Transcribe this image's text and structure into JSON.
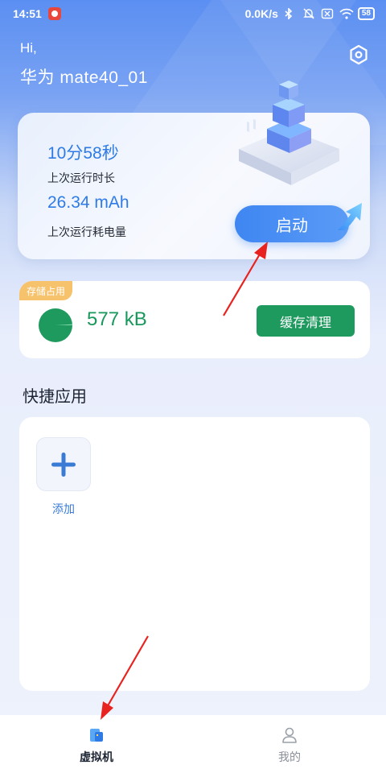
{
  "status_bar": {
    "time": "14:51",
    "net_speed": "0.0K/s",
    "battery": "58"
  },
  "header": {
    "hi": "Hi,",
    "device_name": "华为 mate40_01"
  },
  "run_card": {
    "last_run_duration": "10分58秒",
    "last_run_duration_label": "上次运行时长",
    "last_run_power": "26.34 mAh",
    "last_run_power_label": "上次运行耗电量",
    "start_label": "启动"
  },
  "storage": {
    "tag": "存储占用",
    "size": "577 kB",
    "clean_label": "缓存清理",
    "usage_fraction": 0.01
  },
  "quick_apps": {
    "title": "快捷应用",
    "add_label": "添加"
  },
  "bottom_nav": {
    "items": [
      {
        "label": "虚拟机",
        "icon": "vm-icon",
        "active": true
      },
      {
        "label": "我的",
        "icon": "person-icon",
        "active": false
      }
    ]
  },
  "colors": {
    "accent": "#3f86f2",
    "storage_green": "#1f9a5f",
    "annotation_red": "#e8231f"
  }
}
